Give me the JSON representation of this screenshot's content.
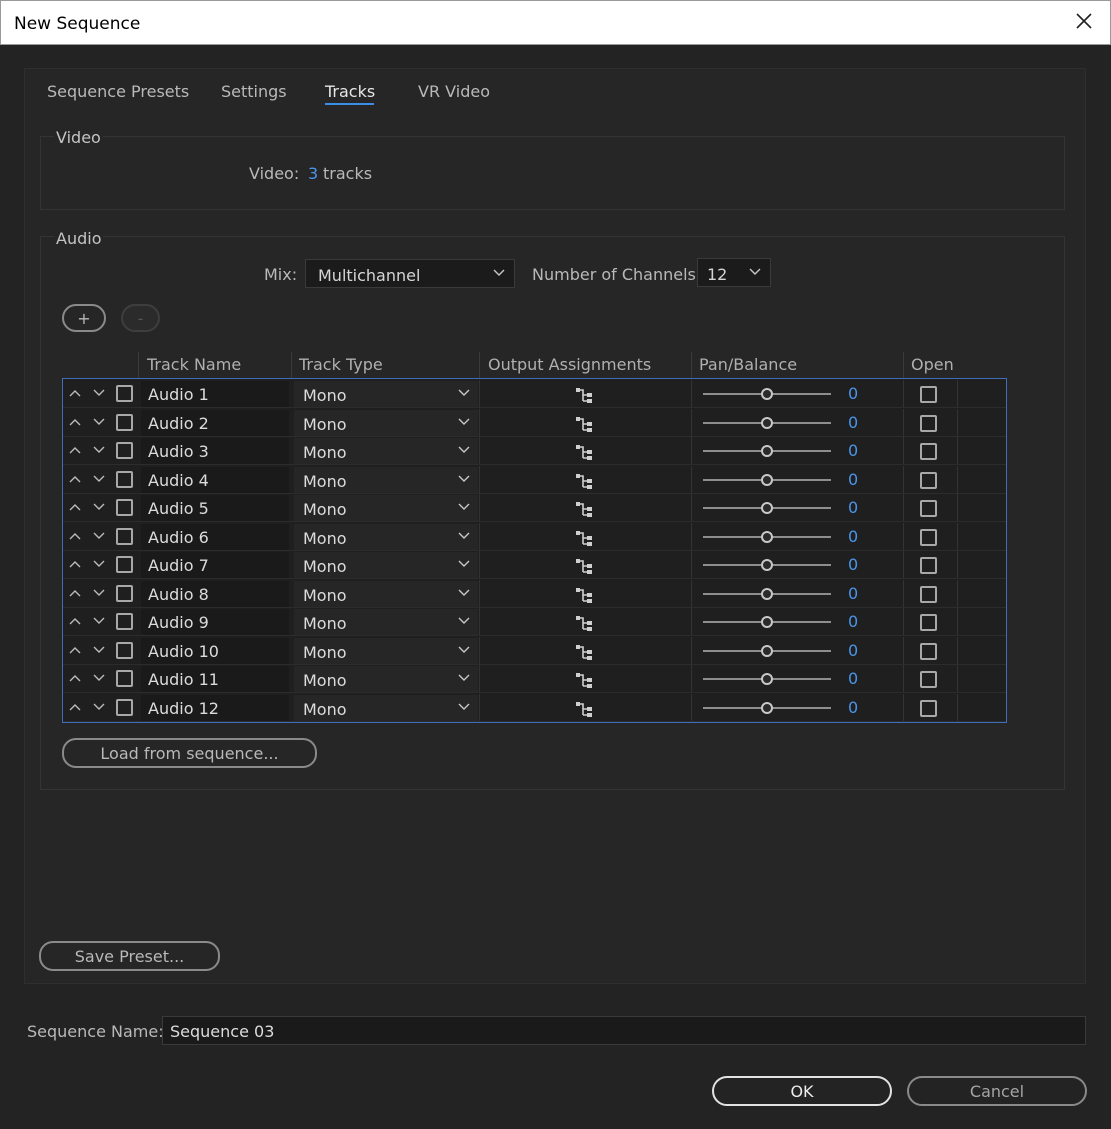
{
  "window": {
    "title": "New Sequence"
  },
  "tabs": [
    {
      "label": "Sequence Presets",
      "active": false
    },
    {
      "label": "Settings",
      "active": false
    },
    {
      "label": "Tracks",
      "active": true
    },
    {
      "label": "VR Video",
      "active": false
    }
  ],
  "video": {
    "section_label": "Video",
    "video_label": "Video:",
    "count": "3",
    "unit": "tracks"
  },
  "audio": {
    "section_label": "Audio",
    "mix_label": "Mix:",
    "mix_value": "Multichannel",
    "channels_label": "Number of Channels:",
    "channels_value": "12",
    "add_label": "+",
    "remove_label": "-",
    "columns": {
      "track_name": "Track Name",
      "track_type": "Track Type",
      "output": "Output Assignments",
      "pan": "Pan/Balance",
      "open": "Open"
    },
    "tracks": [
      {
        "name": "Audio 1",
        "type": "Mono",
        "pan": "0"
      },
      {
        "name": "Audio 2",
        "type": "Mono",
        "pan": "0"
      },
      {
        "name": "Audio 3",
        "type": "Mono",
        "pan": "0"
      },
      {
        "name": "Audio 4",
        "type": "Mono",
        "pan": "0"
      },
      {
        "name": "Audio 5",
        "type": "Mono",
        "pan": "0"
      },
      {
        "name": "Audio 6",
        "type": "Mono",
        "pan": "0"
      },
      {
        "name": "Audio 7",
        "type": "Mono",
        "pan": "0"
      },
      {
        "name": "Audio 8",
        "type": "Mono",
        "pan": "0"
      },
      {
        "name": "Audio 9",
        "type": "Mono",
        "pan": "0"
      },
      {
        "name": "Audio 10",
        "type": "Mono",
        "pan": "0"
      },
      {
        "name": "Audio 11",
        "type": "Mono",
        "pan": "0"
      },
      {
        "name": "Audio 12",
        "type": "Mono",
        "pan": "0"
      }
    ],
    "load_label": "Load from sequence..."
  },
  "save_preset_label": "Save Preset...",
  "sequence_name": {
    "label": "Sequence Name:",
    "value": "Sequence 03"
  },
  "buttons": {
    "ok": "OK",
    "cancel": "Cancel"
  },
  "colors": {
    "accent": "#4a95ea",
    "tracks_border": "#3d6fb8",
    "background": "#232323"
  }
}
